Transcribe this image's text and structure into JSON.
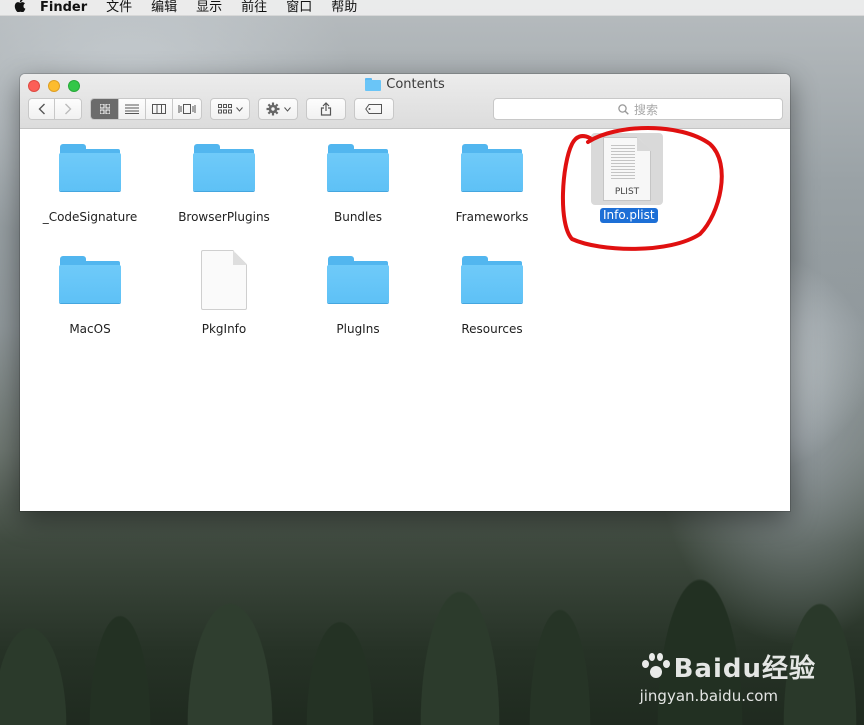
{
  "menubar": {
    "apple": "",
    "app": "Finder",
    "items": [
      "文件",
      "编辑",
      "显示",
      "前往",
      "窗口",
      "帮助"
    ]
  },
  "window": {
    "title": "Contents",
    "search_placeholder": "搜索"
  },
  "items_row1": [
    {
      "label": "_CodeSignature",
      "kind": "folder"
    },
    {
      "label": "BrowserPlugins",
      "kind": "folder"
    },
    {
      "label": "Bundles",
      "kind": "folder"
    },
    {
      "label": "Frameworks",
      "kind": "folder"
    }
  ],
  "selected_file": {
    "label": "Info.plist",
    "ext": "PLIST",
    "selected": true
  },
  "items_row2": [
    {
      "label": "MacOS",
      "kind": "folder"
    },
    {
      "label": "PkgInfo",
      "kind": "document"
    },
    {
      "label": "PlugIns",
      "kind": "folder"
    },
    {
      "label": "Resources",
      "kind": "folder"
    }
  ],
  "watermark": {
    "brand": "Baidu经验",
    "url": "jingyan.baidu.com"
  },
  "colors": {
    "folder": "#6ac5f7",
    "selection": "#1d6fd6",
    "annotation": "#e01010"
  }
}
